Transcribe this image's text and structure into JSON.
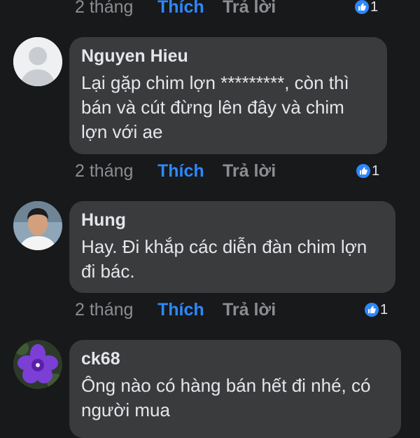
{
  "top_meta": {
    "time": "2 tháng",
    "like_label": "Thích",
    "reply_label": "Trả lời",
    "reaction_count": "1"
  },
  "comments": [
    {
      "author": "Nguyen Hieu",
      "text": "Lại gặp chim lợn *********, còn thì bán và cút đừng lên đây và chim lợn với ae",
      "avatar": "default-avatar",
      "time": "2 tháng",
      "like_label": "Thích",
      "reply_label": "Trả lời",
      "reaction_count": "1"
    },
    {
      "author": "Hung",
      "text": "Hay. Đi khắp các diễn đàn chim lợn đi bác.",
      "avatar": "photo-avatar",
      "time": "2 tháng",
      "like_label": "Thích",
      "reply_label": "Trả lời",
      "reaction_count": "1"
    },
    {
      "author": "ck68",
      "text": "Ông nào có hàng bán hết đi nhé, có người mua",
      "avatar": "flower-avatar"
    }
  ],
  "colors": {
    "background": "#18191a",
    "bubble": "#3a3b3c",
    "accent": "#2d88ff",
    "muted": "#8a8d91",
    "text": "#e4e6eb"
  }
}
